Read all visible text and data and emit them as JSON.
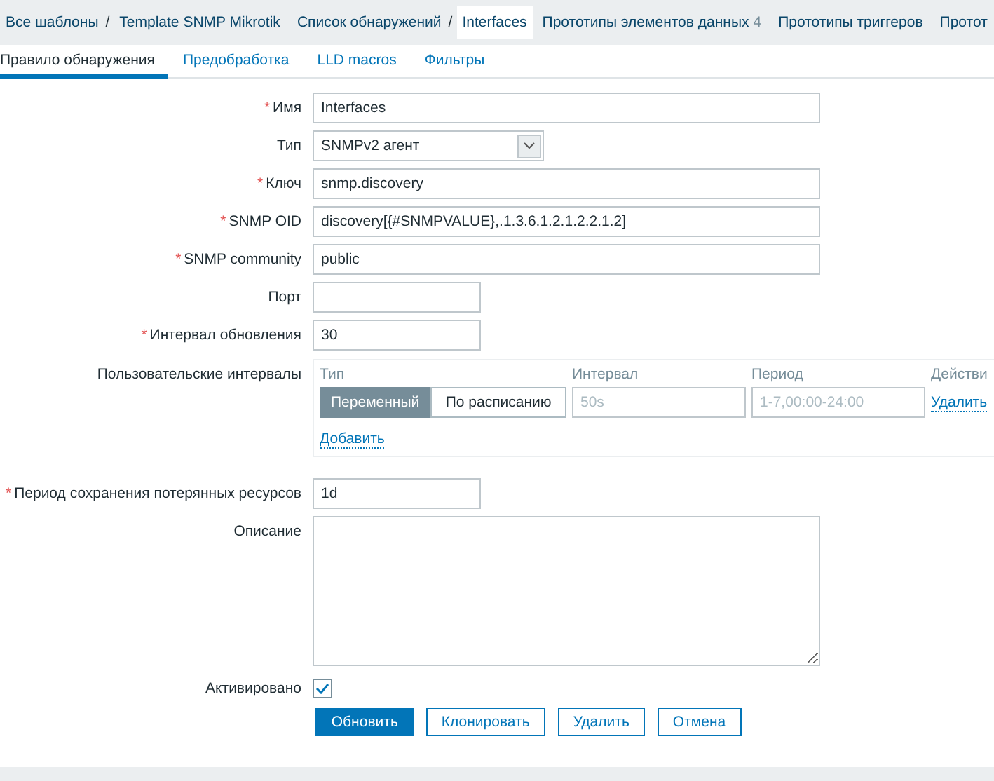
{
  "breadcrumbs": [
    {
      "label": "Все шаблоны",
      "separator": "/",
      "selected": false
    },
    {
      "label": "Template SNMP Mikrotik",
      "selected": false
    },
    {
      "label": "Список обнаружений",
      "separator": "/",
      "selected": false
    },
    {
      "label": "Interfaces",
      "selected": true
    },
    {
      "label": "Прототипы элементов данных",
      "count": "4",
      "selected": false
    },
    {
      "label": "Прототипы триггеров",
      "selected": false
    },
    {
      "label": "Протот",
      "selected": false
    }
  ],
  "tabs": [
    {
      "label": "Правило обнаружения",
      "selected": true
    },
    {
      "label": "Предобработка",
      "selected": false
    },
    {
      "label": "LLD macros",
      "selected": false
    },
    {
      "label": "Фильтры",
      "selected": false
    }
  ],
  "form": {
    "fields": [
      {
        "kind": "text",
        "label": "Имя",
        "mark": "*",
        "value": "Interfaces"
      },
      {
        "kind": "select",
        "label": "Тип",
        "value": "SNMPv2 агент"
      },
      {
        "kind": "text",
        "label": "Ключ",
        "mark": "*",
        "value": "snmp.discovery"
      },
      {
        "kind": "text",
        "label": "SNMP OID",
        "mark": "*",
        "value": "discovery[{#SNMPVALUE},.1.3.6.1.2.1.2.2.1.2]"
      },
      {
        "kind": "text",
        "label": "SNMP community",
        "mark": "*",
        "value": "public"
      },
      {
        "kind": "short",
        "label": "Порт"
      },
      {
        "kind": "short",
        "label": "Интервал обновления",
        "mark": "*",
        "value": "30"
      },
      {
        "kind": "intervals",
        "label": "Пользовательские интервалы",
        "columns": [
          "Тип",
          "Интервал",
          "Период",
          "Действи"
        ],
        "rows": [
          {
            "types": [
              {
                "label": "Переменный",
                "selected": true
              },
              {
                "label": "По расписанию",
                "selected": false
              }
            ],
            "interval_placeholder": "50s",
            "period_placeholder": "1-7,00:00-24:00",
            "action": "Удалить"
          }
        ],
        "add": "Добавить"
      },
      {
        "kind": "short",
        "label": "Период сохранения потерянных ресурсов",
        "mark": "*",
        "value": "1d"
      },
      {
        "kind": "textarea",
        "label": "Описание"
      },
      {
        "kind": "checkbox",
        "label": "Активировано",
        "checked": true
      }
    ],
    "buttons": [
      {
        "label": "Обновить",
        "primary": true
      },
      {
        "label": "Клонировать",
        "primary": false
      },
      {
        "label": "Удалить",
        "primary": false
      },
      {
        "label": "Отмена",
        "primary": false
      }
    ]
  }
}
